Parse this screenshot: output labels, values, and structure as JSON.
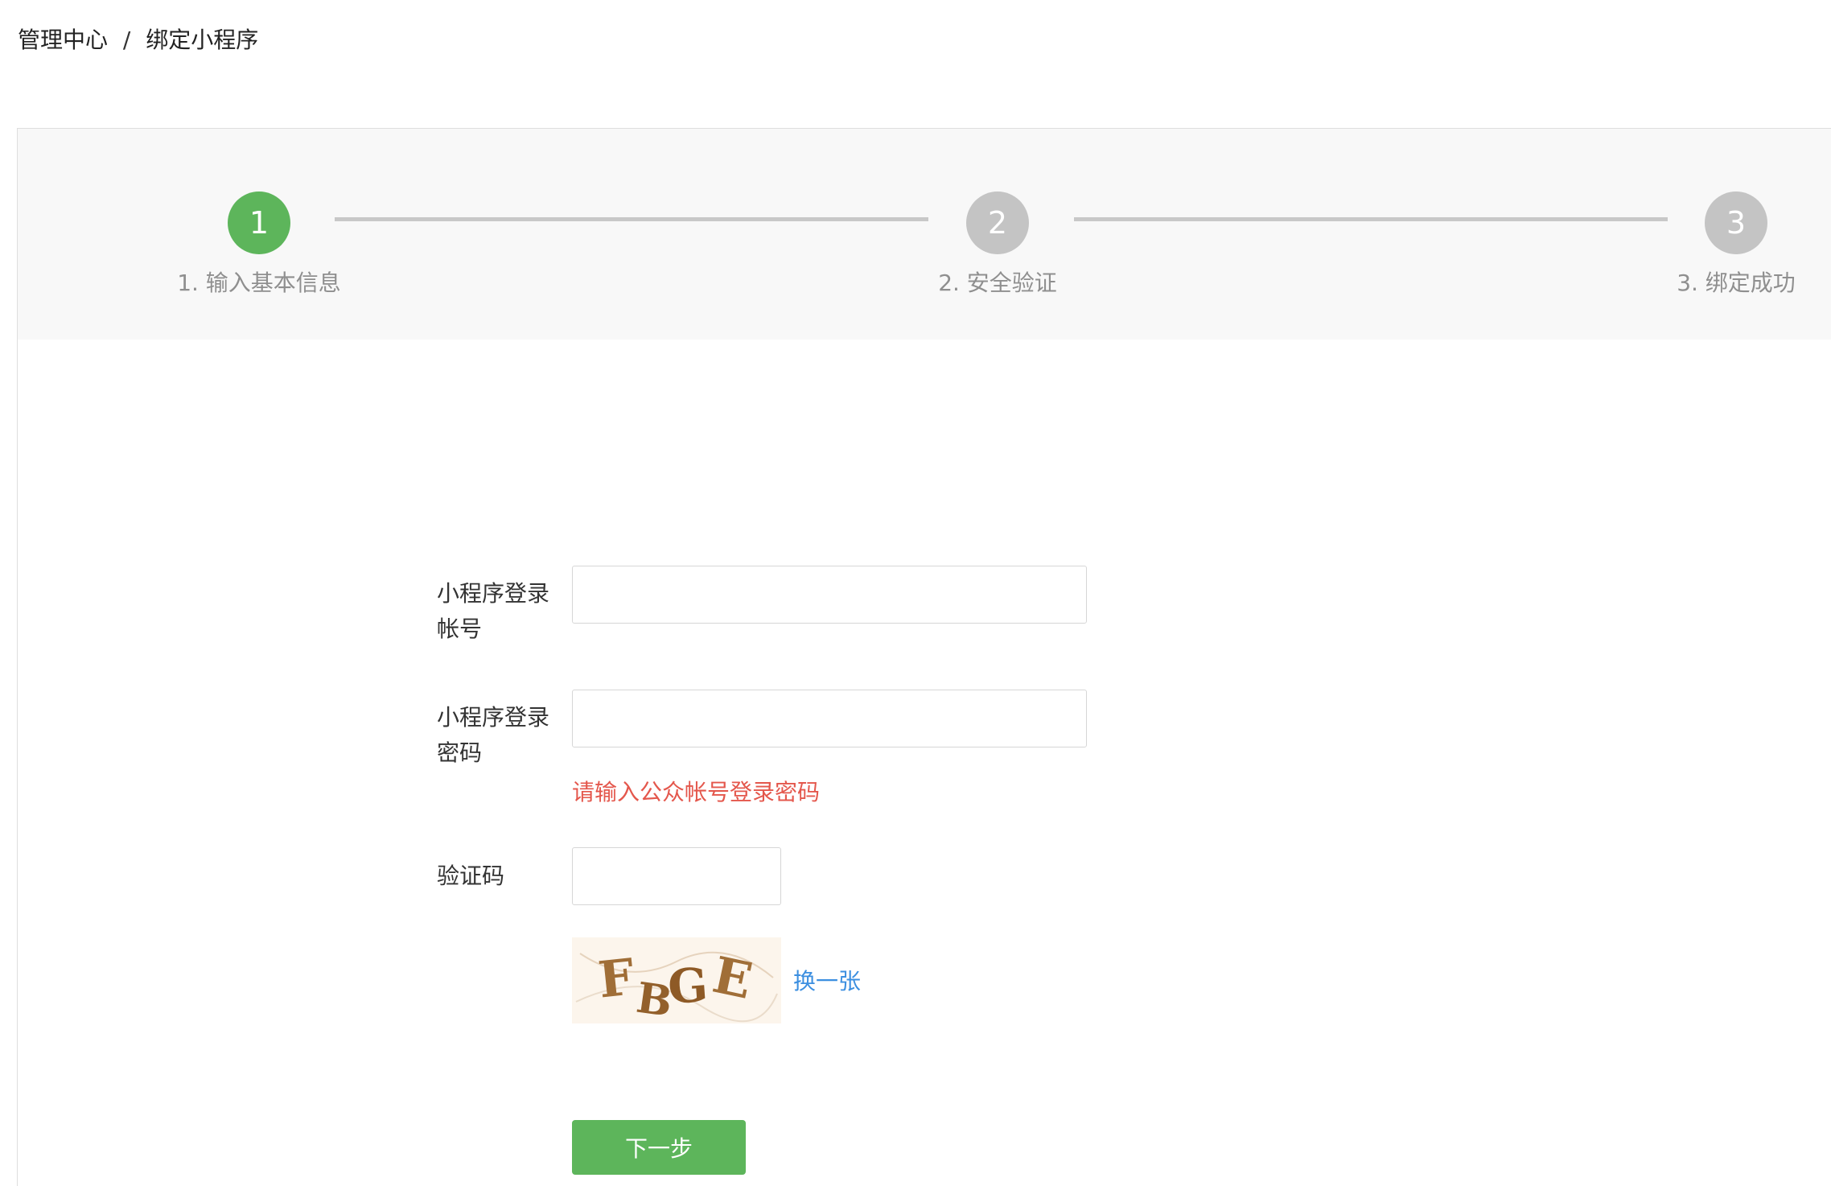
{
  "breadcrumb": {
    "root": "管理中心",
    "separator": "/",
    "current": "绑定小程序"
  },
  "steps": [
    {
      "number": "1",
      "label": "1. 输入基本信息",
      "state": "active"
    },
    {
      "number": "2",
      "label": "2. 安全验证",
      "state": "inactive"
    },
    {
      "number": "3",
      "label": "3. 绑定成功",
      "state": "inactive"
    }
  ],
  "form": {
    "account": {
      "label_line1": "小程序登录",
      "label_line2": "帐号",
      "value": "",
      "placeholder": ""
    },
    "password": {
      "label_line1": "小程序登录",
      "label_line2": "密码",
      "value": "",
      "placeholder": "",
      "error": "请输入公众帐号登录密码"
    },
    "captcha": {
      "label": "验证码",
      "value": "",
      "image_text": "FBGE",
      "refresh_label": "换一张"
    },
    "next_label": "下一步"
  },
  "colors": {
    "accent": "#5db55b",
    "inactive_step": "#c4c4c4",
    "error": "#e4574c",
    "link": "#3c8fe0"
  }
}
